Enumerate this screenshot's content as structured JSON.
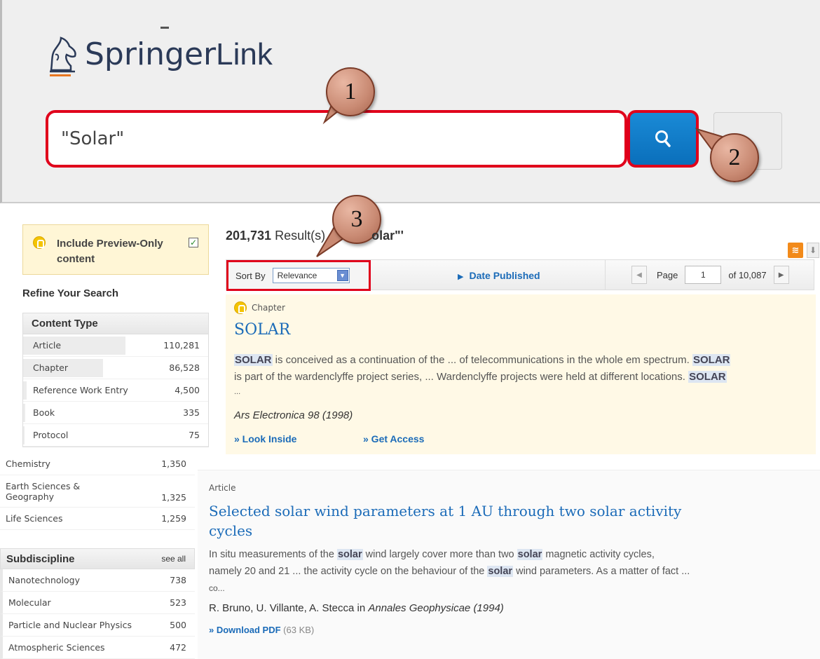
{
  "header": {
    "brand_springer": "Springer",
    "brand_link": "Link",
    "search_value": "\"Solar\""
  },
  "callouts": [
    "1",
    "2",
    "3"
  ],
  "sidebar": {
    "preview_label": "Include Preview-Only content",
    "preview_checked": true,
    "refine_title": "Refine Your Search",
    "content_type": {
      "title": "Content Type",
      "items": [
        {
          "label": "Article",
          "count": "110,281",
          "share": 0.55
        },
        {
          "label": "Chapter",
          "count": "86,528",
          "share": 0.43
        },
        {
          "label": "Reference Work Entry",
          "count": "4,500",
          "share": 0.02
        },
        {
          "label": "Book",
          "count": "335",
          "share": 0.01
        },
        {
          "label": "Protocol",
          "count": "75",
          "share": 0.005
        }
      ]
    },
    "discipline": {
      "items": [
        {
          "label": "Chemistry",
          "count": "1,350"
        },
        {
          "label": "Earth Sciences & Geography",
          "count": "1,325"
        },
        {
          "label": "Life Sciences",
          "count": "1,259"
        }
      ]
    },
    "subdiscipline": {
      "title": "Subdiscipline",
      "see_all": "see all",
      "items": [
        {
          "label": "Nanotechnology",
          "count": "738"
        },
        {
          "label": "Molecular",
          "count": "523"
        },
        {
          "label": "Particle and Nuclear Physics",
          "count": "500"
        },
        {
          "label": "Atmospheric Sciences",
          "count": "472"
        }
      ]
    }
  },
  "results": {
    "count": "201,731",
    "label_prefix": "Result(s)",
    "label_suffix": "olar\"'",
    "sort_label": "Sort By",
    "sort_value": "Relevance",
    "date_published": "Date Published",
    "page_label": "Page",
    "page_value": "1",
    "page_total": "of 10,087"
  },
  "result1": {
    "type": "Chapter",
    "title": "SOLAR",
    "line1_hl1": "SOLAR",
    "line1_mid": " is conceived as a continuation of the ... of telecommunications in the whole em spectrum. ",
    "line1_hl2": "SOLAR",
    "line2_pre": "is part of the wardenclyffe project series, ... Wardenclyffe projects were held at different locations. ",
    "line2_hl": "SOLAR",
    "line3": "...",
    "source": "Ars Electronica 98 (1998)",
    "link_look": "» Look Inside",
    "link_access": "» Get Access"
  },
  "result2": {
    "type": "Article",
    "title_line1": "Selected solar wind parameters at 1 AU through two solar activity",
    "title_line2": "cycles",
    "t1_a": "In situ measurements of the ",
    "t1_hl1": "solar",
    "t1_b": " wind largely cover more than two ",
    "t1_hl2": "solar",
    "t1_c": " magnetic activity cycles,",
    "t2_a": "namely 20 and 21 ... the activity cycle on the behaviour of the ",
    "t2_hl": "solar",
    "t2_b": " wind parameters. As a matter of fact ...",
    "t3": "co...",
    "authors": "R. Bruno, U. Villante, A. Stecca in ",
    "journal": "Annales Geophysicae (1994)",
    "download": "» Download PDF",
    "size": " (63 KB)"
  },
  "colors": {
    "accent_red": "#e0001b",
    "link_blue": "#1b6bb8",
    "search_blue": "#0a6fbb",
    "highlight_yellow": "#fff9e6"
  }
}
